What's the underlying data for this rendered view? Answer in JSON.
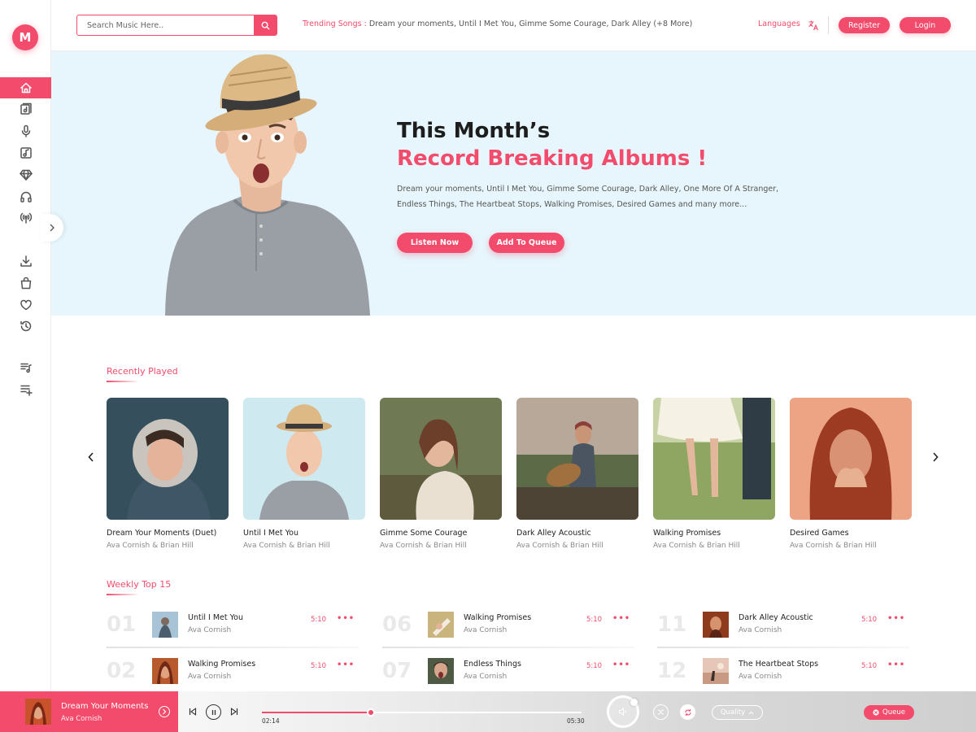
{
  "app": {
    "logo_letter": "M",
    "accent": "#f34b6b",
    "hero_bg": "#e6f6fc"
  },
  "sidebar": {
    "items": [
      {
        "icon": "home-icon",
        "active": true
      },
      {
        "icon": "album-icon",
        "active": false
      },
      {
        "icon": "microphone-icon",
        "active": false
      },
      {
        "icon": "music-note-icon",
        "active": false
      },
      {
        "icon": "diamond-icon",
        "active": false
      },
      {
        "icon": "headphones-icon",
        "active": false
      },
      {
        "icon": "radio-icon",
        "active": false
      },
      {
        "icon": "download-icon",
        "active": false
      },
      {
        "icon": "shopping-bag-icon",
        "active": false
      },
      {
        "icon": "heart-icon",
        "active": false
      },
      {
        "icon": "history-icon",
        "active": false
      },
      {
        "icon": "playlist-icon",
        "active": false
      },
      {
        "icon": "playlist-add-icon",
        "active": false
      }
    ]
  },
  "header": {
    "search_placeholder": "Search Music Here..",
    "trending_label": "Trending Songs :",
    "trending_text": "Dream your moments, Until I Met You, Gimme Some Courage, Dark Alley (+8 More)",
    "languages_label": "Languages",
    "register_label": "Register",
    "login_label": "Login"
  },
  "hero": {
    "title": "This Month’s",
    "subtitle": "Record Breaking Albums !",
    "description": "Dream your moments, Until I Met You, Gimme Some Courage, Dark Alley, One More Of A Stranger, Endless Things, The Heartbeat Stops, Walking Promises, Desired Games and many more...",
    "listen_label": "Listen Now",
    "queue_label": "Add To Queue"
  },
  "recently_played": {
    "heading": "Recently Played",
    "items": [
      {
        "title": "Dream Your Moments (Duet)",
        "artist": "Ava Cornish & Brian Hill"
      },
      {
        "title": "Until I Met You",
        "artist": "Ava Cornish & Brian Hill"
      },
      {
        "title": "Gimme Some Courage",
        "artist": "Ava Cornish & Brian Hill"
      },
      {
        "title": "Dark Alley Acoustic",
        "artist": "Ava Cornish & Brian Hill"
      },
      {
        "title": "Walking Promises",
        "artist": "Ava Cornish & Brian Hill"
      },
      {
        "title": "Desired Games",
        "artist": "Ava Cornish & Brian Hill"
      }
    ]
  },
  "weekly_top": {
    "heading": "Weekly Top 15",
    "items": [
      {
        "rank": "01",
        "title": "Until I Met You",
        "artist": "Ava Cornish",
        "duration": "5:10",
        "more": "•••"
      },
      {
        "rank": "02",
        "title": "Walking Promises",
        "artist": "Ava Cornish",
        "duration": "5:10",
        "more": "•••"
      },
      {
        "rank": "06",
        "title": "Walking Promises",
        "artist": "Ava Cornish",
        "duration": "5:10",
        "more": "•••"
      },
      {
        "rank": "07",
        "title": "Endless Things",
        "artist": "Ava Cornish",
        "duration": "5:10",
        "more": "•••"
      },
      {
        "rank": "11",
        "title": "Dark Alley Acoustic",
        "artist": "Ava Cornish",
        "duration": "5:10",
        "more": "•••"
      },
      {
        "rank": "12",
        "title": "The Heartbeat Stops",
        "artist": "Ava Cornish",
        "duration": "5:10",
        "more": "•••"
      }
    ]
  },
  "player": {
    "title": "Dream Your Moments",
    "artist": "Ava Cornish",
    "elapsed": "02:14",
    "total": "05:30",
    "progress_fraction": 0.34,
    "quality_label": "Quality",
    "queue_label": "Queue"
  }
}
